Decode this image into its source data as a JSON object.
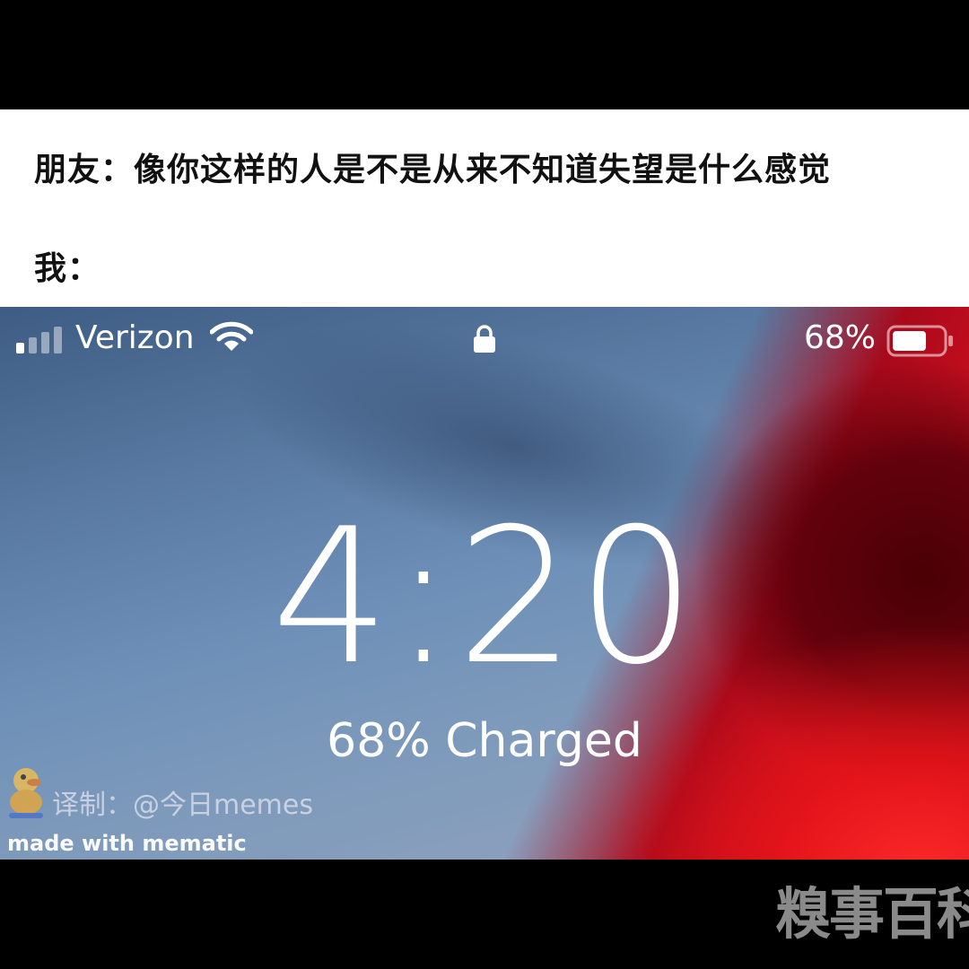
{
  "caption": {
    "friend_line": "朋友：像你这样的人是不是从来不知道失望是什么感觉",
    "me_line": "我："
  },
  "status_bar": {
    "carrier": "Verizon",
    "battery_text": "68%",
    "battery_level": 0.68,
    "icons": [
      "signal-icon",
      "wifi-icon",
      "lock-icon",
      "battery-icon"
    ]
  },
  "lock_screen": {
    "time": "4:20",
    "charge_status": "68% Charged"
  },
  "watermarks": {
    "translator": "译制：@今日memes",
    "mematic": "made with mematic",
    "brand": "糗事百科"
  },
  "colors": {
    "caption_bg": "#ffffff",
    "frame_bg": "#000000",
    "wallpaper_blue": "#6d8fb7",
    "wallpaper_red": "#e01420"
  }
}
